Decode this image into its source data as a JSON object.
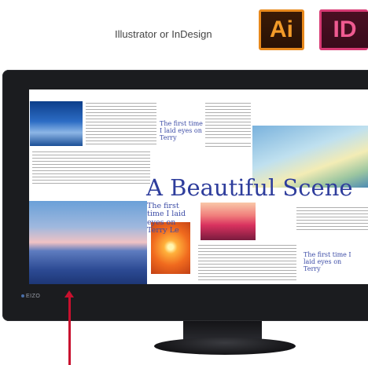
{
  "header": {
    "caption": "Illustrator or InDesign",
    "apps": [
      {
        "label": "Ai",
        "icon": "illustrator-app-icon",
        "color": "#f29b29"
      },
      {
        "label": "ID",
        "icon": "indesign-app-icon",
        "color": "#ef5a91"
      }
    ]
  },
  "layout": {
    "title": "A Beautiful Scene",
    "subheads": [
      "The first time I laid eyes on Terry",
      "The first time I laid eyes on Terry Le",
      "The first time I laid eyes on Terry"
    ]
  },
  "monitor": {
    "brand": "EIZO"
  }
}
